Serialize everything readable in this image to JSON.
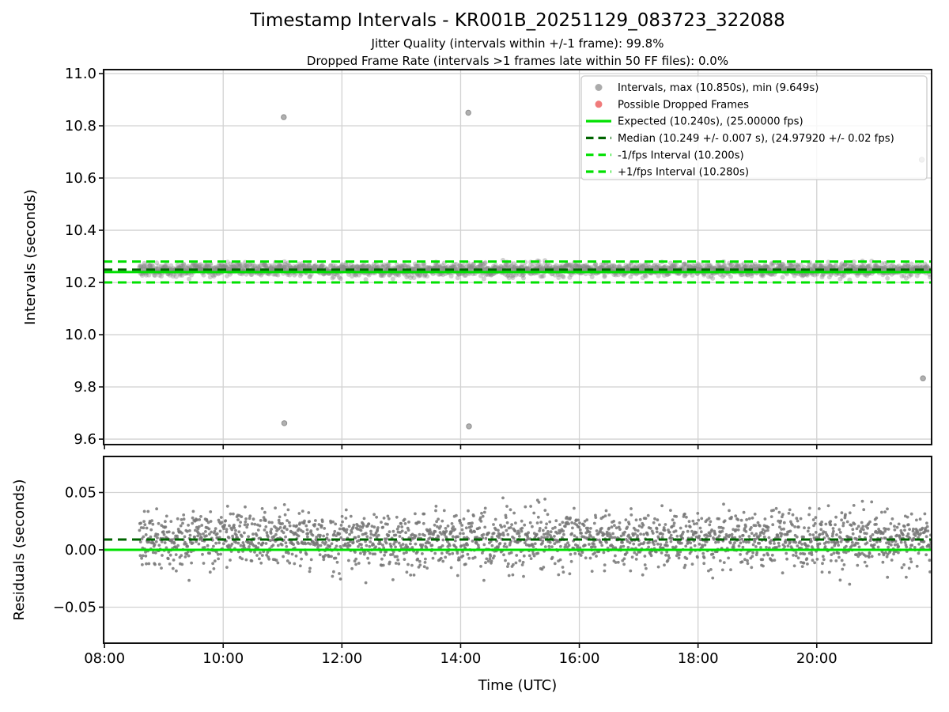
{
  "title": "Timestamp Intervals - KR001B_20251129_083723_322088",
  "subtitle_jitter": "Jitter Quality (intervals within +/-1 frame): 99.8%",
  "subtitle_dropped": "Dropped Frame Rate (intervals >1 frames late within 50 FF files): 0.0%",
  "colors": {
    "bright_green": "#00e000",
    "dark_green": "#006400",
    "interval_point_gray": "#858585",
    "residual_point_gray": "#757575",
    "dropped_frame_red": "#f07b7b",
    "legend_dot_gray": "#ababab",
    "gridline": "#d2d2d2",
    "spine": "#0f0f0f"
  },
  "chart_data": {
    "type": "scatter",
    "title": "Timestamp Intervals - KR001B_20251129_083723_322088",
    "grid": true,
    "x_axis": {
      "label": "Time (UTC)",
      "tick_labels": [
        "08:00",
        "10:00",
        "12:00",
        "14:00",
        "16:00",
        "18:00",
        "20:00"
      ],
      "tick_hours": [
        8,
        10,
        12,
        14,
        16,
        18,
        20
      ],
      "xlim_hours": [
        7.985,
        21.935
      ]
    },
    "panels": [
      {
        "name": "intervals",
        "ylabel": "Intervals (seconds)",
        "ylim": [
          9.579,
          11.0152
        ],
        "ytick_values": [
          9.6,
          9.8,
          10.0,
          10.2,
          10.4,
          10.6,
          10.8,
          11.0
        ],
        "ytick_labels": [
          "9.6",
          "9.8",
          "10.0",
          "10.2",
          "10.4",
          "10.6",
          "10.8",
          "11.0"
        ],
        "show_x_tick_labels": false,
        "hlines": [
          {
            "name": "plus-1fps-interval",
            "value": 10.28,
            "color": "#00e000",
            "style": "dashed"
          },
          {
            "name": "median-interval",
            "value": 10.249,
            "color": "#006400",
            "style": "dashed"
          },
          {
            "name": "expected-interval",
            "value": 10.24,
            "color": "#00e000",
            "style": "solid"
          },
          {
            "name": "minus-1fps-interval",
            "value": 10.2,
            "color": "#00e000",
            "style": "dashed"
          }
        ]
      },
      {
        "name": "residuals",
        "ylabel": "Residuals (seconds)",
        "ylim": [
          -0.0814,
          0.0814
        ],
        "ytick_values": [
          -0.05,
          0.0,
          0.05
        ],
        "ytick_labels": [
          "−0.05",
          "0.00",
          "0.05"
        ],
        "show_x_tick_labels": true,
        "hlines": [
          {
            "name": "median-residual",
            "value": 0.009,
            "color": "#006400",
            "style": "dashed"
          },
          {
            "name": "zero-residual",
            "value": 0.0,
            "color": "#00e000",
            "style": "solid"
          }
        ]
      }
    ],
    "series": {
      "expected_interval_s": 10.24,
      "expected_fps": "25.00000",
      "median_interval_s": 10.249,
      "median_interval_tol_s": 0.007,
      "median_fps": "24.97920",
      "median_fps_tol": 0.02,
      "minus_1fps_interval_s": 10.2,
      "plus_1fps_interval_s": 10.28,
      "max_interval_s": 10.85,
      "min_interval_s": 9.649,
      "jitter_quality_pct": 99.8,
      "dropped_frame_rate_pct": 0.0,
      "data_start_hour": 8.59,
      "data_end_hour": 21.93,
      "n_points": 2300,
      "residual_median_s": 0.009,
      "residual_sigma_s": 0.012,
      "residual_clip_s": [
        -0.032,
        0.0465
      ],
      "outlier_points": [
        {
          "time_hour": 11.02,
          "interval_s": 10.833
        },
        {
          "time_hour": 11.03,
          "interval_s": 9.661
        },
        {
          "time_hour": 14.13,
          "interval_s": 10.85
        },
        {
          "time_hour": 14.14,
          "interval_s": 9.649
        },
        {
          "time_hour": 21.77,
          "interval_s": 10.67
        },
        {
          "time_hour": 21.79,
          "interval_s": 9.833
        }
      ]
    },
    "legend": {
      "position": "top-right",
      "items": [
        {
          "marker": "dot",
          "color": "#ababab",
          "label": "Intervals, max (10.850s), min (9.649s)"
        },
        {
          "marker": "dot",
          "color": "#f07b7b",
          "label": "Possible Dropped Frames"
        },
        {
          "marker": "solid-line",
          "color": "#00e000",
          "label": "Expected (10.240s), (25.00000 fps)"
        },
        {
          "marker": "dashed-line",
          "color": "#006400",
          "label": "Median (10.249 +/- 0.007 s), (24.97920 +/- 0.02 fps)"
        },
        {
          "marker": "dashed-line",
          "color": "#00e000",
          "label": "-1/fps Interval (10.200s)"
        },
        {
          "marker": "dashed-line",
          "color": "#00e000",
          "label": "+1/fps Interval (10.280s)"
        }
      ]
    }
  }
}
